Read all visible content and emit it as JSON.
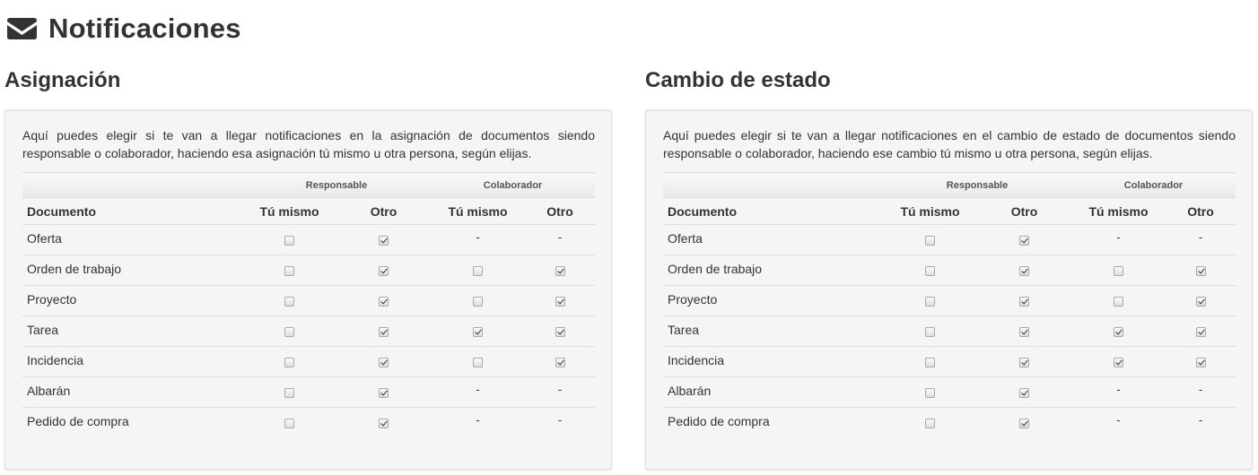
{
  "page": {
    "title": "Notificaciones",
    "icon": "envelope-icon"
  },
  "sections": [
    {
      "title": "Asignación",
      "description": "Aquí puedes elegir si te van a llegar notificaciones en la asignación de documentos siendo responsable o colaborador, haciendo esa asignación tú mismo u otra persona, según elijas.",
      "groups": [
        "Responsable",
        "Colaborador"
      ],
      "columns": [
        "Documento",
        "Tú mismo",
        "Otro",
        "Tú mismo",
        "Otro"
      ],
      "rows": [
        {
          "label": "Oferta",
          "cells": [
            false,
            true,
            "-",
            "-"
          ]
        },
        {
          "label": "Orden de trabajo",
          "cells": [
            false,
            true,
            false,
            true
          ]
        },
        {
          "label": "Proyecto",
          "cells": [
            false,
            true,
            false,
            true
          ]
        },
        {
          "label": "Tarea",
          "cells": [
            false,
            true,
            true,
            true
          ]
        },
        {
          "label": "Incidencia",
          "cells": [
            false,
            true,
            false,
            true
          ]
        },
        {
          "label": "Albarán",
          "cells": [
            false,
            true,
            "-",
            "-"
          ]
        },
        {
          "label": "Pedido de compra",
          "cells": [
            false,
            true,
            "-",
            "-"
          ]
        }
      ]
    },
    {
      "title": "Cambio de estado",
      "description": "Aquí puedes elegir si te van a llegar notificaciones en el cambio de estado de documentos siendo responsable o colaborador, haciendo ese cambio tú mismo u otra persona, según elijas.",
      "groups": [
        "Responsable",
        "Colaborador"
      ],
      "columns": [
        "Documento",
        "Tú mismo",
        "Otro",
        "Tú mismo",
        "Otro"
      ],
      "rows": [
        {
          "label": "Oferta",
          "cells": [
            false,
            true,
            "-",
            "-"
          ]
        },
        {
          "label": "Orden de trabajo",
          "cells": [
            false,
            true,
            false,
            true
          ]
        },
        {
          "label": "Proyecto",
          "cells": [
            false,
            true,
            false,
            true
          ]
        },
        {
          "label": "Tarea",
          "cells": [
            false,
            true,
            true,
            true
          ]
        },
        {
          "label": "Incidencia",
          "cells": [
            false,
            true,
            true,
            true
          ]
        },
        {
          "label": "Albarán",
          "cells": [
            false,
            true,
            "-",
            "-"
          ]
        },
        {
          "label": "Pedido de compra",
          "cells": [
            false,
            true,
            "-",
            "-"
          ]
        }
      ]
    }
  ]
}
